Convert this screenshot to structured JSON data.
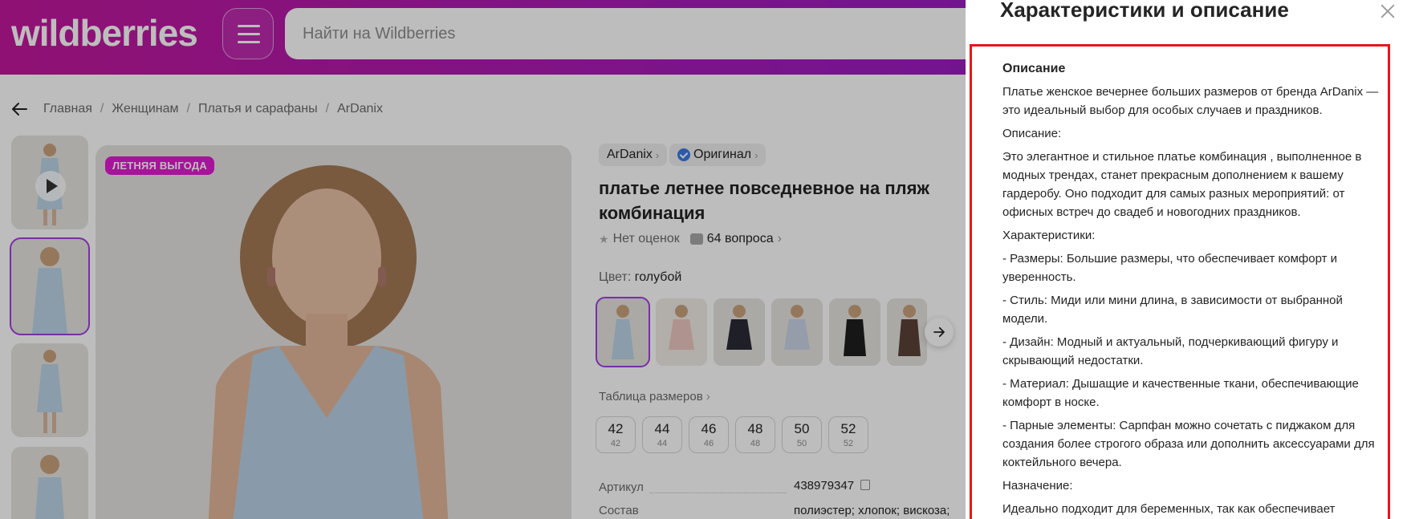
{
  "header": {
    "logo": "wildberries",
    "search_placeholder": "Найти на Wildberries"
  },
  "breadcrumb": [
    "Главная",
    "Женщинам",
    "Платья и сарафаны",
    "ArDanix"
  ],
  "gallery": {
    "badge": "ЛЕТНЯЯ ВЫГОДА"
  },
  "product": {
    "brand": "ArDanix",
    "original_label": "Оригинал",
    "title": "платье летнее повседневное на пляж комбинация",
    "rating_text": "Нет оценок",
    "questions_text": "64 вопроса",
    "color_label": "Цвет:",
    "color_value": "голубой",
    "size_table_label": "Таблица размеров",
    "sizes": [
      {
        "ru": "42",
        "intl": "42"
      },
      {
        "ru": "44",
        "intl": "44"
      },
      {
        "ru": "46",
        "intl": "46"
      },
      {
        "ru": "48",
        "intl": "48"
      },
      {
        "ru": "50",
        "intl": "50"
      },
      {
        "ru": "52",
        "intl": "52"
      }
    ],
    "specs": [
      {
        "label": "Артикул",
        "value": "438979347"
      },
      {
        "label": "Состав",
        "value": "полиэстер; хлопок; вискоза;"
      }
    ]
  },
  "panel": {
    "title": "Характеристики и описание",
    "section_heading": "Описание",
    "paragraphs": [
      "Платье женское вечернее больших размеров от бренда ArDanix — это идеальный выбор для особых случаев и праздников.",
      "Описание:",
      "Это элегантное и стильное платье комбинация , выполненное в модных трендах, станет прекрасным дополнением к вашему гардеробу. Оно подходит для самых разных мероприятий: от офисных встреч до свадеб и новогодних праздников.",
      "Характеристики:",
      "- Размеры: Большие размеры, что обеспечивает комфорт и уверенность.",
      "- Стиль: Миди или мини длина, в зависимости от выбранной модели.",
      "- Дизайн: Модный и актуальный, подчеркивающий фигуру и скрывающий недостатки.",
      "- Материал: Дышащие и качественные ткани, обеспечивающие комфорт в носке.",
      "- Парные элементы: Сарпфан можно сочетать с пиджаком для создания более строгого образа или дополнить аксессуарами для коктейльного вечера.",
      "Назначение:",
      "Идеально подходит для беременных, так как обеспечивает"
    ]
  }
}
